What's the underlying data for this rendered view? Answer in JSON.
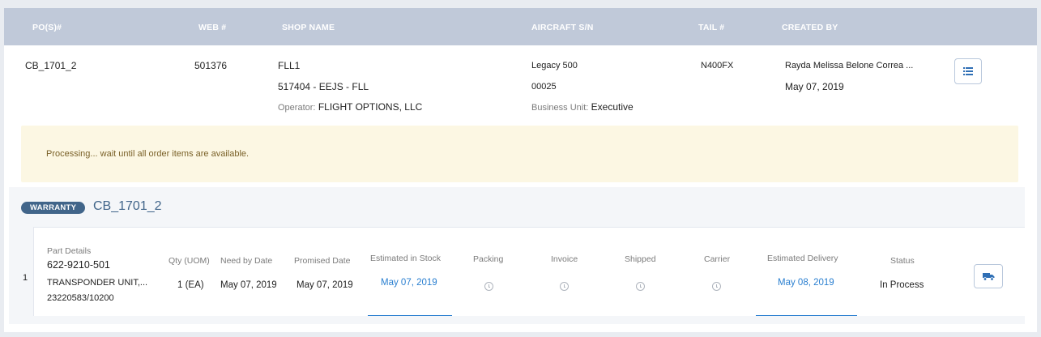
{
  "header": {
    "pos": "PO(S)#",
    "web": "WEB #",
    "shop_name": "SHOP NAME",
    "aircraft_sn": "AIRCRAFT S/N",
    "tail": "TAIL #",
    "created_by": "CREATED BY"
  },
  "order": {
    "pos": "CB_1701_2",
    "web": "501376",
    "shop_line1": "FLL1",
    "shop_line2": "517404 - EEJS - FLL",
    "operator_label": "Operator:",
    "operator_value": "FLIGHT OPTIONS, LLC",
    "aircraft_model": "Legacy 500",
    "aircraft_sn": "00025",
    "business_unit_label": "Business Unit:",
    "business_unit_value": "Executive",
    "tail": "N400FX",
    "created_by_name": "Rayda Melissa Belone Correa ...",
    "created_date": "May 07, 2019",
    "list_icon": "list-icon"
  },
  "alert": {
    "message": "Processing... wait until all order items are available.",
    "color": "#fcf7e3"
  },
  "warranty": {
    "badge": "WARRANTY",
    "title": "CB_1701_2",
    "accent": "#41658a"
  },
  "item": {
    "row_number": "1",
    "columns": {
      "part_details": "Part Details",
      "qty": "Qty (UOM)",
      "need_by": "Need by Date",
      "promised": "Promised Date",
      "est_stock": "Estimated in Stock",
      "packing": "Packing",
      "invoice": "Invoice",
      "shipped": "Shipped",
      "carrier": "Carrier",
      "est_delivery": "Estimated Delivery",
      "status": "Status"
    },
    "part_number": "622-9210-501",
    "part_desc": "TRANSPONDER UNIT,...",
    "part_ref": "23220583/10200",
    "qty": "1 (EA)",
    "need_by": "May 07, 2019",
    "promised": "May 07, 2019",
    "est_stock": "May 07, 2019",
    "est_delivery": "May 08, 2019",
    "status": "In Process",
    "link_color": "#2a7fd0",
    "pending_icon": "clock-icon",
    "action_icon": "truck-icon"
  }
}
